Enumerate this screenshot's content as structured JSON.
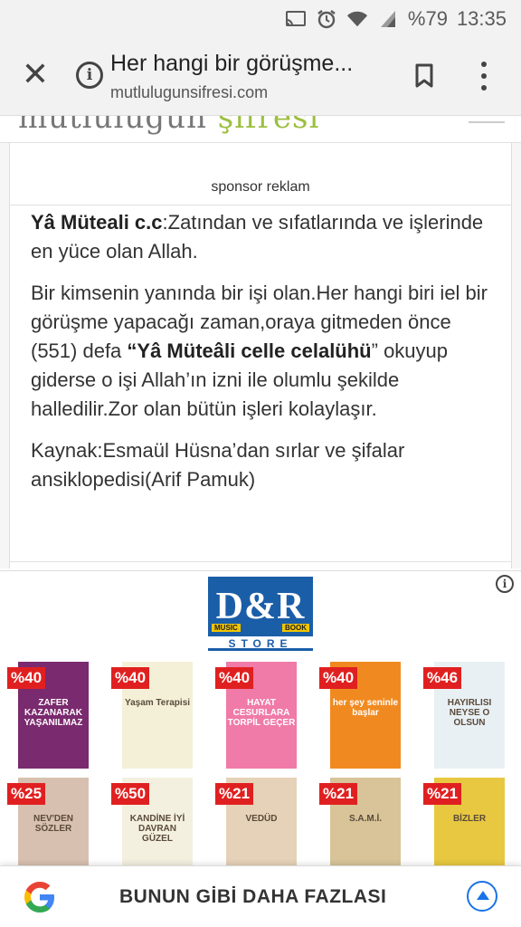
{
  "status_bar": {
    "battery": "%79",
    "time": "13:35",
    "icons": [
      "cast-icon",
      "alarm-icon",
      "wifi-icon",
      "signal-icon"
    ]
  },
  "browser": {
    "page_title": "Her hangi bir görüşme...",
    "url": "mutlulugunsifresi.com",
    "icons": [
      "close-icon",
      "info-icon",
      "bookmark-icon",
      "more-vert-icon"
    ]
  },
  "site": {
    "logo_text_a": "mutlulugun",
    "logo_text_b": "şifresi"
  },
  "sponsor_label": "sponsor reklam",
  "article": {
    "p1_bold": "Yâ Müteali c.c",
    "p1_rest": ":Zatından ve sıfatlarında ve işlerinde en yüce olan Allah.",
    "p2_a": "Bir kimsenin yanında  bir işi olan.Her hangi biri iel bir görüşme yapacağı zaman,oraya gitmeden önce (551) defa  ",
    "p2_bold": "“Yâ Müteâli celle celalühü",
    "p2_b": "” okuyup giderse o işi Allah’ın izni ile olumlu şekilde halledilir.Zor olan bütün işleri kolaylaşır.",
    "p3": "Kaynak:Esmaül Hüsna’dan sırlar ve şifalar ansiklopedisi(Arif Pamuk)"
  },
  "ad": {
    "brand_main": "D&R",
    "brand_music": "MUSIC",
    "brand_book": "BOOK",
    "brand_store": "STORE",
    "books": [
      {
        "discount": "%40",
        "title": "ZAFER KAZANARAK YAŞANILMAZ",
        "color": "#7a2a6e"
      },
      {
        "discount": "%40",
        "title": "Yaşam Terapisi",
        "color": "#f4f0d8"
      },
      {
        "discount": "%40",
        "title": "HAYAT CESURLARA TORPİL GEÇER",
        "color": "#f07aa8"
      },
      {
        "discount": "%40",
        "title": "her şey seninle başlar",
        "color": "#f08a20"
      },
      {
        "discount": "%46",
        "title": "HAYIRLISI NEYSE O OLSUN",
        "color": "#e8f0f4"
      },
      {
        "discount": "%25",
        "title": "NEV'DEN SÖZLER",
        "color": "#d8c0b0"
      },
      {
        "discount": "%50",
        "title": "KANDİNE İYİ DAVRAN GÜZEL",
        "color": "#f4f0e0"
      },
      {
        "discount": "%21",
        "title": "VEDÜD",
        "color": "#e6d2b8"
      },
      {
        "discount": "%21",
        "title": "S.A.M.İ.",
        "color": "#d8c498"
      },
      {
        "discount": "%21",
        "title": "BİZLER",
        "color": "#e8c840"
      }
    ]
  },
  "bottom_bar": {
    "label": "BUNUN GİBİ DAHA FAZLASI"
  }
}
